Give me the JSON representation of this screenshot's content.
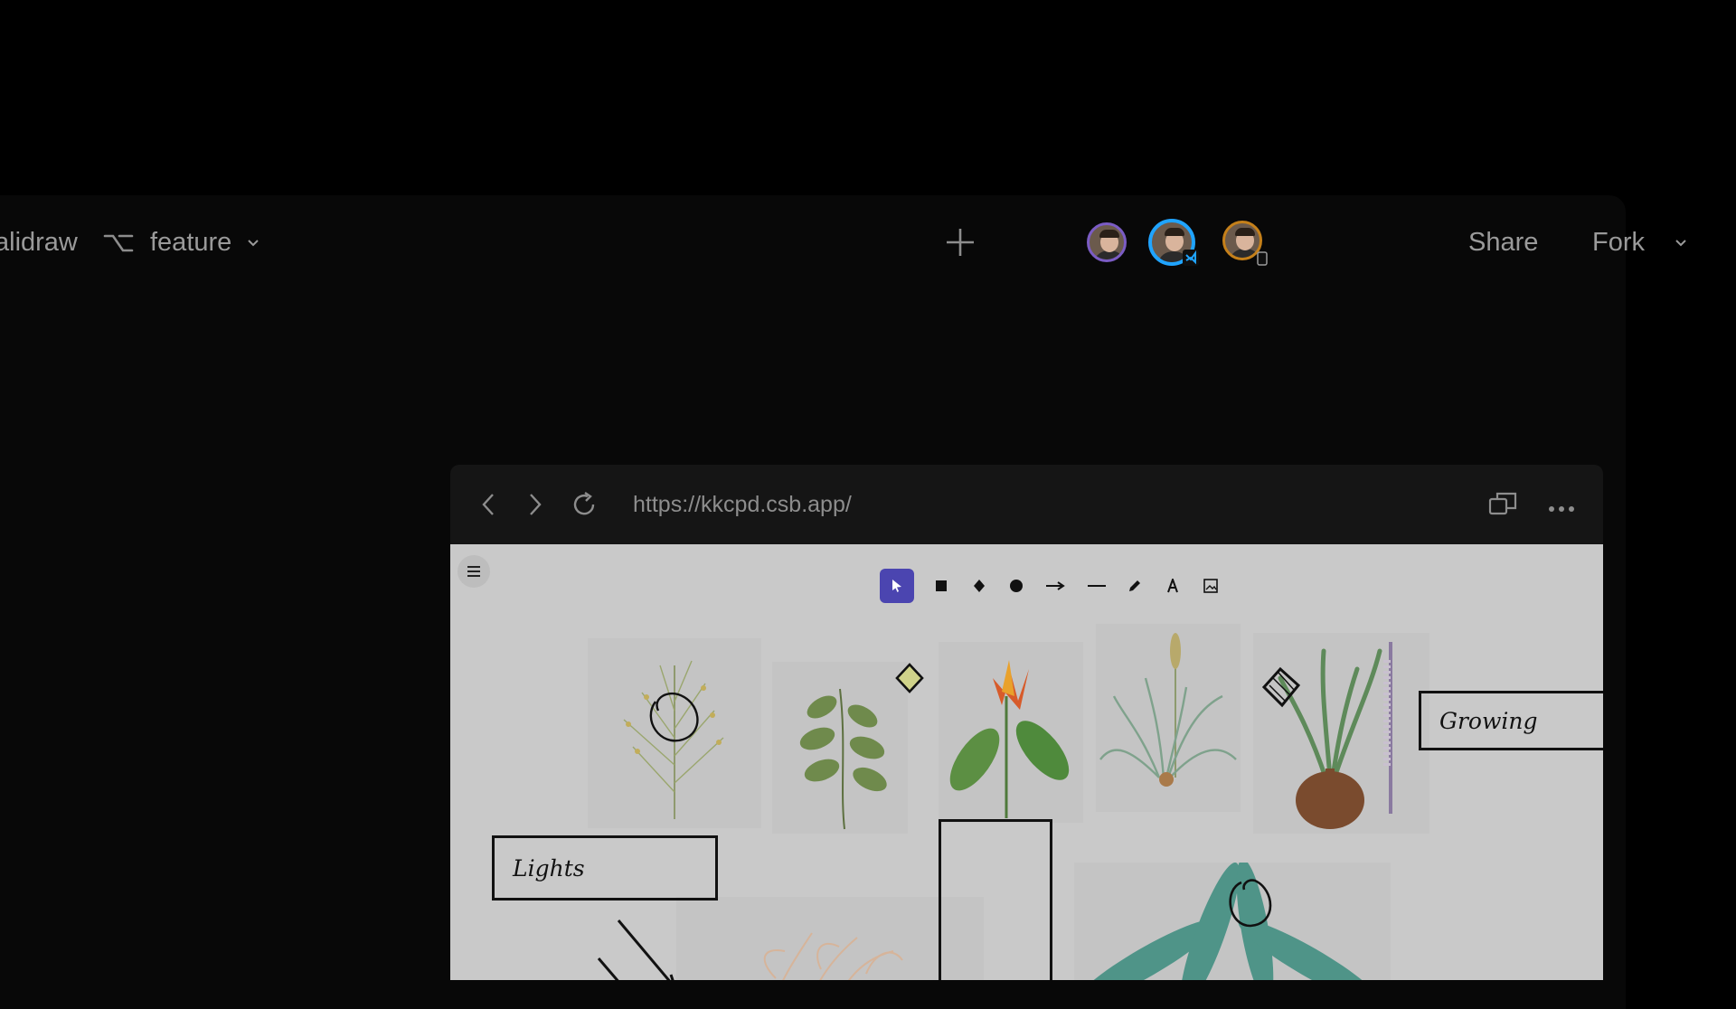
{
  "editor": {
    "project_name": "alidraw",
    "branch_name": "feature",
    "share_label": "Share",
    "fork_label": "Fork"
  },
  "collaborators": [
    {
      "name": "avatar-1",
      "ring": "#7b5cc4"
    },
    {
      "name": "avatar-2",
      "ring": "#20a4ff"
    },
    {
      "name": "avatar-3",
      "ring": "#c5801a"
    }
  ],
  "preview": {
    "url": "https://kkcpd.csb.app/",
    "toolbar_tools": [
      "selection",
      "rectangle",
      "diamond",
      "ellipse",
      "arrow",
      "line",
      "draw",
      "text",
      "image"
    ],
    "labels": {
      "lights": "Lights",
      "growing": "Growing"
    }
  },
  "colors": {
    "accent": "#4b45b0",
    "canvas": "#c9c9c9"
  }
}
